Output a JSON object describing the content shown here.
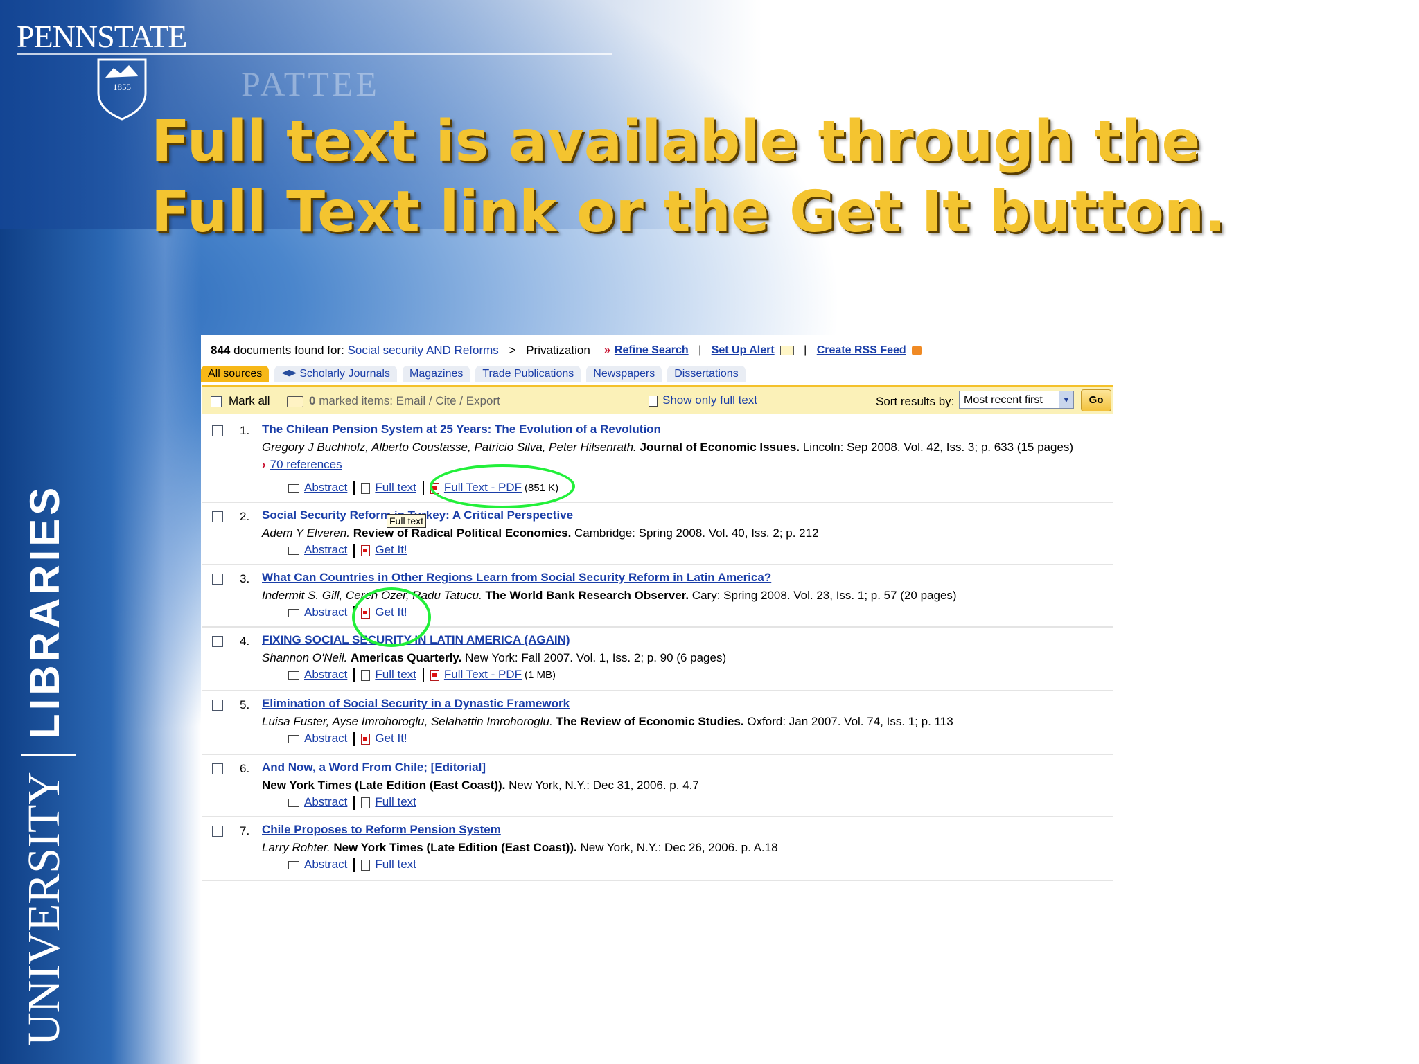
{
  "slide": {
    "logo_text": "PENNSTATE",
    "shield_text": "1855",
    "watermark": "PATTEE",
    "vertical_left": "UNIVERSITY",
    "vertical_right": "LIBRARIES",
    "title": "Full text is available through the Full Text link or the Get It button.",
    "colors": {
      "title": "#f4c430",
      "band": "#2c69b5",
      "highlight": "#22f03a"
    }
  },
  "search": {
    "count": "844",
    "found_text": "documents found for:",
    "query": "Social security AND Reforms",
    "separator": ">",
    "subject": "Privatization",
    "refine": "Refine Search",
    "alert": "Set Up Alert",
    "rss": "Create RSS Feed",
    "pipe": "|"
  },
  "tabs": [
    {
      "label": "All sources",
      "active": true
    },
    {
      "label": "Scholarly Journals",
      "active": false,
      "icon": "graduation-cap-icon"
    },
    {
      "label": "Magazines",
      "active": false
    },
    {
      "label": "Trade Publications",
      "active": false
    },
    {
      "label": "Newspapers",
      "active": false
    },
    {
      "label": "Dissertations",
      "active": false
    }
  ],
  "toolbar": {
    "mark_all": "Mark all",
    "marked_count": "0",
    "marked_text": "marked items: Email / Cite / Export",
    "show_full": "Show only full text",
    "sort_label": "Sort results by:",
    "sort_value": "Most recent first",
    "go": "Go"
  },
  "results": [
    {
      "num": "1.",
      "title": "The Chilean Pension System at 25 Years: The Evolution of a Revolution",
      "authors": "Gregory J Buchholz, Alberto Coustasse, Patricio Silva, Peter Hilsenrath.",
      "publication": "Journal of Economic Issues.",
      "details": "Lincoln: Sep 2008. Vol. 42, Iss. 3; p. 633 (15 pages)",
      "references": "70 references",
      "links": {
        "abstract": "Abstract",
        "fulltext": "Full text",
        "pdf": "Full Text - PDF",
        "pdf_size": "(851 K)"
      }
    },
    {
      "num": "2.",
      "title": "Social Security Reform in Turkey: A Critical Perspective",
      "authors": "Adem Y Elveren.",
      "publication": "Review of Radical Political Economics.",
      "details": "Cambridge: Spring 2008. Vol. 40, Iss. 2; p. 212",
      "links": {
        "abstract": "Abstract",
        "getit": "Get It!"
      }
    },
    {
      "num": "3.",
      "title": "What Can Countries in Other Regions Learn from Social Security Reform in Latin America?",
      "authors": "Indermit S. Gill, Ceren Ozer, Radu Tatucu.",
      "publication": "The World Bank Research Observer.",
      "details": "Cary: Spring 2008. Vol. 23, Iss. 1; p. 57 (20 pages)",
      "links": {
        "abstract": "Abstract",
        "getit": "Get It!"
      }
    },
    {
      "num": "4.",
      "title": "FIXING SOCIAL SECURITY IN LATIN AMERICA (AGAIN)",
      "authors": "Shannon O'Neil.",
      "publication": "Americas Quarterly.",
      "details": "New York: Fall 2007. Vol. 1, Iss. 2; p. 90 (6 pages)",
      "links": {
        "abstract": "Abstract",
        "fulltext": "Full text",
        "pdf": "Full Text - PDF",
        "pdf_size": "(1 MB)"
      }
    },
    {
      "num": "5.",
      "title": "Elimination of Social Security in a Dynastic Framework",
      "authors": "Luisa Fuster, Ayse Imrohoroglu, Selahattin Imrohoroglu.",
      "publication": "The Review of Economic Studies.",
      "details": "Oxford: Jan 2007. Vol. 74, Iss. 1; p. 113",
      "links": {
        "abstract": "Abstract",
        "getit": "Get It!"
      }
    },
    {
      "num": "6.",
      "title": "And Now, a Word From Chile; [Editorial]",
      "authors": "",
      "publication": "New York Times (Late Edition (East Coast)).",
      "details": "New York, N.Y.: Dec 31, 2006. p. 4.7",
      "links": {
        "abstract": "Abstract",
        "fulltext": "Full text"
      }
    },
    {
      "num": "7.",
      "title": "Chile Proposes to Reform Pension System",
      "authors": "Larry Rohter.",
      "publication": "New York Times (Late Edition (East Coast)).",
      "details": "New York, N.Y.: Dec 26, 2006. p. A.18",
      "links": {
        "abstract": "Abstract",
        "fulltext": "Full text"
      }
    }
  ],
  "tooltip": "Full text"
}
